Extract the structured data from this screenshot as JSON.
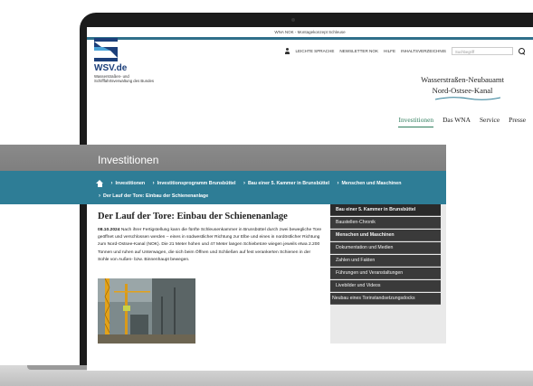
{
  "topbar": {
    "text": "WNA NOK - Montagekonzept Schleuse"
  },
  "utility": {
    "links": [
      "LEICHTE SPRACHE",
      "NEWSLETTER NOK",
      "HILFE",
      "INHALTSVERZEICHNIS"
    ],
    "search_placeholder": "Suchbegriff"
  },
  "logo": {
    "name": "WSV.de",
    "subtitle": "Wasserstraßen- und Schifffahrtsverwaltung des Bundes"
  },
  "authority": {
    "line1": "Wasserstraßen-Neubauamt",
    "line2": "Nord-Ostsee-Kanal"
  },
  "mainnav": {
    "items": [
      "Investitionen",
      "Das WNA",
      "Service",
      "Presse"
    ],
    "active_index": 0,
    "active_color": "#2e7d5c"
  },
  "hero": {
    "title": "Investitionen"
  },
  "breadcrumb": {
    "items": [
      "Investitionen",
      "Investitionsprogramm Brunsbüttel",
      "Bau einer 5. Kammer in Brunsbüttel",
      "Menschen und Maschinen",
      "Der Lauf der Tore: Einbau der Schienenanlage"
    ]
  },
  "article": {
    "title": "Der Lauf der Tore: Einbau der Schienenanlage",
    "date": "08.10.2024",
    "body": "Nach ihrer Fertigstellung kann die fünfte Schleusenkammer in Brunsbüttel durch zwei bewegliche Tore geöffnet und verschlossen werden – eines in südwestlicher Richtung zur Elbe und eines in nordöstlicher Richtung zum Nord-Ostsee-Kanal (NOK). Die 21 Meter hohen und 47 Meter langen Schiebetore wiegen jeweils etwa 2.200 Tonnen und ruhen auf Unterwagen, die sich beim Öffnen und Schließen auf fest verankerten Schienen in der Sohle von Außen- bzw. Binnenhaupt bewegen."
  },
  "sidebar": {
    "items": [
      "Bau einer 5. Kammer in Brunsbüttel",
      "Baustellen-Chronik",
      "Menschen und Maschinen",
      "Dokumentation und Medien",
      "Zahlen und Fakten",
      "Führungen und Veranstaltungen",
      "Livebilder und Videos",
      "Neubau eines Torinstandsetzungsdocks"
    ]
  },
  "colors": {
    "brand_blue": "#1c3f7a",
    "teal_bar": "#2e7d96",
    "sidebar_dark": "#3a3a3a"
  }
}
